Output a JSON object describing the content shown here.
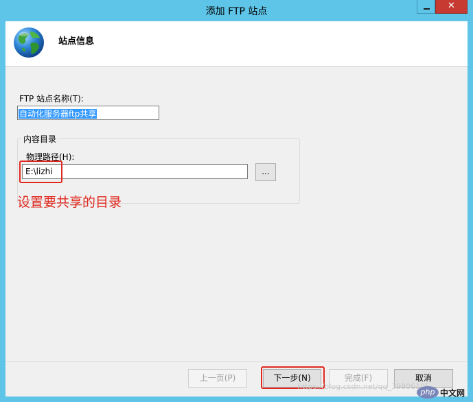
{
  "window": {
    "title": "添加 FTP 站点",
    "close_glyph": "✕"
  },
  "header": {
    "title": "站点信息",
    "icon": "globe-icon"
  },
  "form": {
    "site_name_label": "FTP 站点名称(T):",
    "site_name_value": "自动化服务器ftp共享",
    "group_title": "内容目录",
    "path_label": "物理路径(H):",
    "path_value": "E:\\lizhi",
    "browse_label": "..."
  },
  "annotation": "设置要共享的目录",
  "buttons": {
    "prev": "上一页(P)",
    "next": "下一步(N)",
    "finish": "完成(F)",
    "cancel": "取消"
  },
  "watermark": "https://blog.csdn.net/qq_39806105",
  "site_logo": {
    "logo_text": "php",
    "name": "中文网"
  },
  "colors": {
    "titlebar": "#5fc5e8",
    "close": "#c73a32",
    "annotation": "#e0281e",
    "selection": "#3399ff"
  }
}
